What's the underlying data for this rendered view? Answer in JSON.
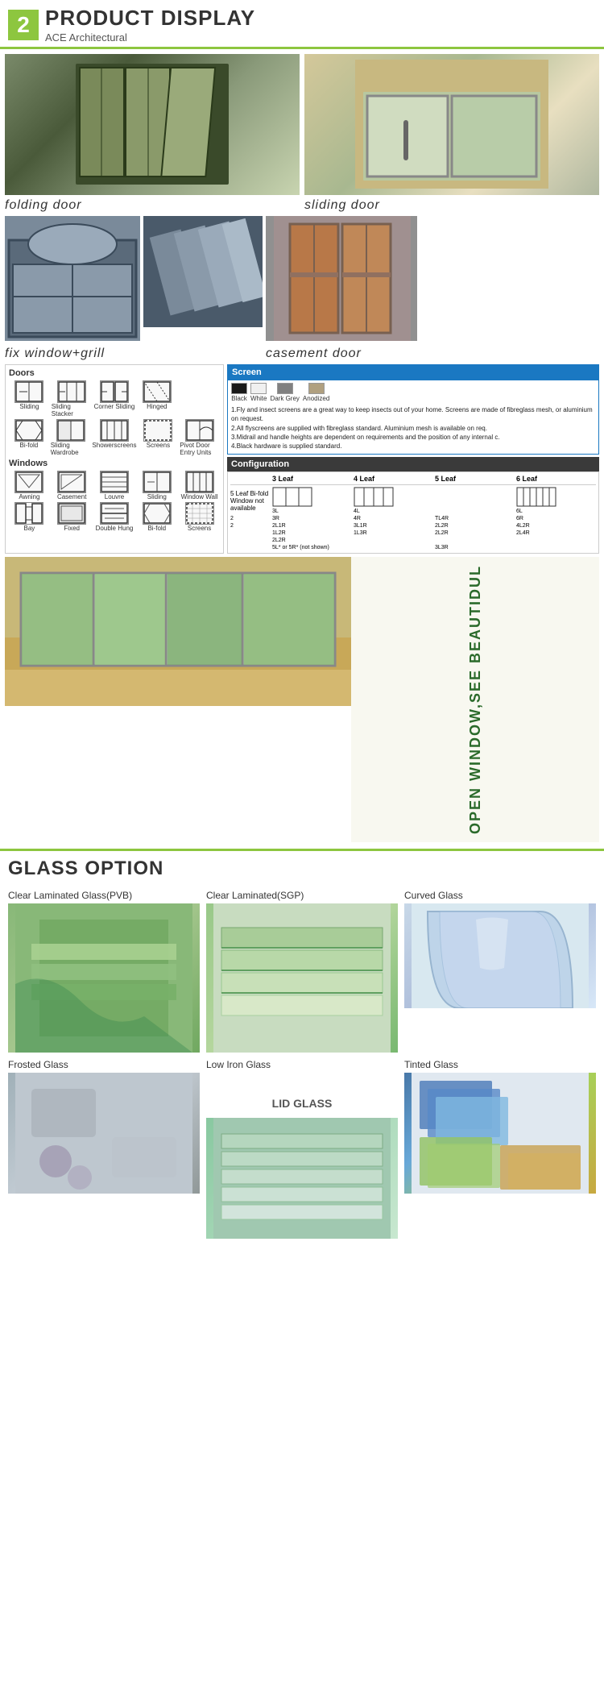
{
  "header": {
    "number": "2",
    "title": "PRODUCT DISPLAY",
    "subtitle": "ACE Architectural",
    "accent_color": "#8dc63f"
  },
  "products": {
    "folding_door_label": "folding door",
    "sliding_door_label": "sliding door",
    "fix_window_label": "fix window+grill",
    "casement_door_label": "casement door"
  },
  "screen": {
    "title": "Screen",
    "points": [
      "1.Fly and insect screens are a great way to keep insects out of your home. Screens are made of fibreglass mesh, or aluminium on request.",
      "2.All flyscreens are supplied with fibreglass standard. Aluminium mesh is available on req.",
      "3.Midrail and handle heights are dependent on requirements and the position of any internal c.",
      "4.Black hardware is supplied standard."
    ]
  },
  "configuration": {
    "title": "Configuration",
    "headers": [
      "",
      "3 Leaf",
      "4 Leaf",
      "5 Leaf",
      "6 Leaf"
    ]
  },
  "open_window_text": "OPEN WINDOW,SEE BEAUTIDUL",
  "glass_option": {
    "title": "GLASS OPTION",
    "items": [
      {
        "id": "clear-pvb",
        "label": "Clear Laminated Glass(PVB)"
      },
      {
        "id": "clear-sgp",
        "label": "Clear Laminated(SGP)"
      },
      {
        "id": "curved",
        "label": "Curved Glass"
      },
      {
        "id": "frosted",
        "label": "Frosted Glass"
      },
      {
        "id": "low-iron",
        "label": "Low Iron Glass"
      },
      {
        "id": "tinted",
        "label": "Tinted Glass"
      }
    ],
    "lid_glass_label": "LID GLASS"
  },
  "doors": {
    "title": "Doors",
    "items": [
      {
        "label": "Sliding"
      },
      {
        "label": "Sliding Stacker"
      },
      {
        "label": "Corner Sliding"
      },
      {
        "label": "Hinged"
      },
      {
        "label": "Bi-fold"
      },
      {
        "label": "Sliding Wardrobe"
      },
      {
        "label": "Showerscreens"
      },
      {
        "label": "Screens"
      },
      {
        "label": "Pivot Door Entry Units"
      }
    ]
  },
  "windows": {
    "title": "Windows",
    "items": [
      {
        "label": "Awning"
      },
      {
        "label": "Casement"
      },
      {
        "label": "Louvre"
      },
      {
        "label": "Sliding"
      },
      {
        "label": "Window Wall"
      },
      {
        "label": "Bay"
      },
      {
        "label": "Fixed"
      },
      {
        "label": "Double Hung"
      },
      {
        "label": "Bi-fold"
      },
      {
        "label": "Screens"
      }
    ]
  }
}
